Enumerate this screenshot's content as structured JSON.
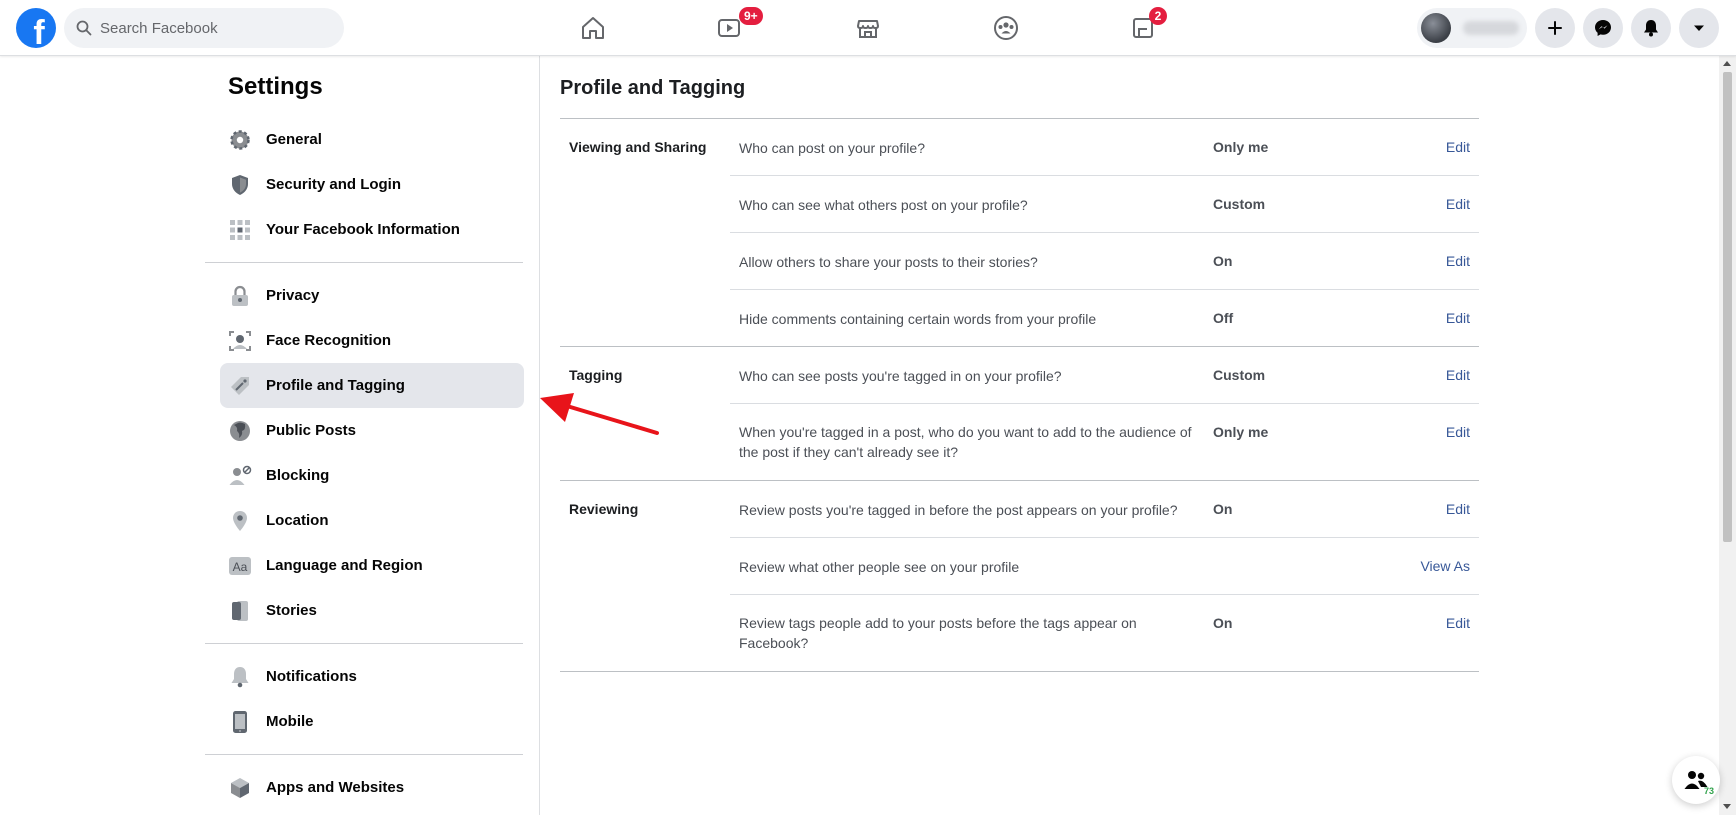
{
  "topbar": {
    "logo": "f",
    "search_placeholder": "Search Facebook",
    "nav": [
      {
        "name": "home",
        "icon": "home-icon",
        "badge": ""
      },
      {
        "name": "watch",
        "icon": "watch-icon",
        "badge": "9+"
      },
      {
        "name": "marketplace",
        "icon": "marketplace-icon",
        "badge": ""
      },
      {
        "name": "groups",
        "icon": "groups-icon",
        "badge": ""
      },
      {
        "name": "gaming",
        "icon": "gaming-icon",
        "badge": "2"
      }
    ],
    "right_buttons": [
      "plus-icon",
      "messenger-icon",
      "bell-icon",
      "caret-down-icon"
    ]
  },
  "sidebar": {
    "title": "Settings",
    "items": [
      {
        "label": "General",
        "icon": "gear-icon"
      },
      {
        "label": "Security and Login",
        "icon": "shield-icon"
      },
      {
        "label": "Your Facebook Information",
        "icon": "grid-icon"
      },
      {
        "label": "Privacy",
        "icon": "lock-icon"
      },
      {
        "label": "Face Recognition",
        "icon": "face-icon"
      },
      {
        "label": "Profile and Tagging",
        "icon": "tag-icon",
        "active": true
      },
      {
        "label": "Public Posts",
        "icon": "globe-icon"
      },
      {
        "label": "Blocking",
        "icon": "block-user-icon"
      },
      {
        "label": "Location",
        "icon": "location-pin-icon"
      },
      {
        "label": "Language and Region",
        "icon": "language-icon"
      },
      {
        "label": "Stories",
        "icon": "stories-icon"
      },
      {
        "label": "Notifications",
        "icon": "bell-icon"
      },
      {
        "label": "Mobile",
        "icon": "mobile-icon"
      },
      {
        "label": "Apps and Websites",
        "icon": "cube-icon"
      }
    ]
  },
  "main": {
    "title": "Profile and Tagging",
    "sections": [
      {
        "label": "Viewing and Sharing",
        "rows": [
          {
            "question": "Who can post on your profile?",
            "value": "Only me",
            "action": "Edit"
          },
          {
            "question": "Who can see what others post on your profile?",
            "value": "Custom",
            "action": "Edit"
          },
          {
            "question": "Allow others to share your posts to their stories?",
            "value": "On",
            "action": "Edit"
          },
          {
            "question": "Hide comments containing certain words from your profile",
            "value": "Off",
            "action": "Edit"
          }
        ]
      },
      {
        "label": "Tagging",
        "rows": [
          {
            "question": "Who can see posts you're tagged in on your profile?",
            "value": "Custom",
            "action": "Edit"
          },
          {
            "question": "When you're tagged in a post, who do you want to add to the audience of the post if they can't already see it?",
            "value": "Only me",
            "action": "Edit"
          }
        ]
      },
      {
        "label": "Reviewing",
        "rows": [
          {
            "question": "Review posts you're tagged in before the post appears on your profile?",
            "value": "On",
            "action": "Edit"
          },
          {
            "question": "Review what other people see on your profile",
            "value": "",
            "action": "View As"
          },
          {
            "question": "Review tags people add to your posts before the tags appear on Facebook?",
            "value": "On",
            "action": "Edit"
          }
        ]
      }
    ]
  },
  "contacts": {
    "count": "73",
    "icon": "contacts-icon"
  },
  "colors": {
    "brand": "#1877f2",
    "link": "#385898",
    "badge": "#e41e3f",
    "annotation": "#e8141a"
  }
}
